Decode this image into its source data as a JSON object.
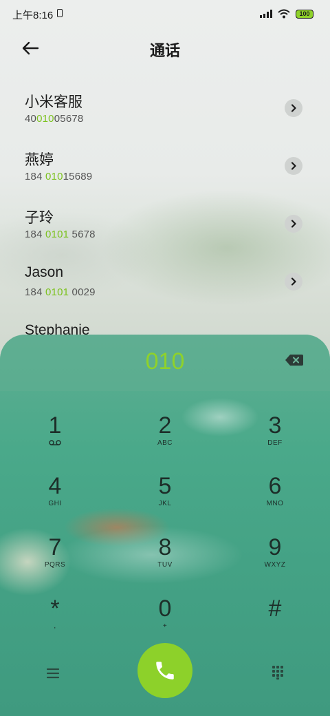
{
  "status": {
    "time": "上午8:16",
    "battery": "100"
  },
  "header": {
    "title": "通话"
  },
  "contacts": [
    {
      "name": "小米客服",
      "num_pre": "40",
      "num_hl": "010",
      "num_post": "05678"
    },
    {
      "name": "燕婷",
      "num_pre": "184 ",
      "num_hl": "010",
      "num_post": "15689"
    },
    {
      "name": "子玲",
      "num_pre": "184 ",
      "num_hl": "0101",
      "num_post": " 5678"
    },
    {
      "name": "Jason",
      "num_pre": "184 ",
      "num_hl": "0101",
      "num_post": " 0029"
    },
    {
      "name": "Stephanie",
      "num_pre": "",
      "num_hl": "",
      "num_post": ""
    }
  ],
  "dialer": {
    "number": "010",
    "keys": [
      {
        "digit": "1",
        "letters": ""
      },
      {
        "digit": "2",
        "letters": "ABC"
      },
      {
        "digit": "3",
        "letters": "DEF"
      },
      {
        "digit": "4",
        "letters": "GHI"
      },
      {
        "digit": "5",
        "letters": "JKL"
      },
      {
        "digit": "6",
        "letters": "MNO"
      },
      {
        "digit": "7",
        "letters": "PQRS"
      },
      {
        "digit": "8",
        "letters": "TUV"
      },
      {
        "digit": "9",
        "letters": "WXYZ"
      },
      {
        "digit": "*",
        "letters": ","
      },
      {
        "digit": "0",
        "letters": "+"
      },
      {
        "digit": "#",
        "letters": ""
      }
    ]
  },
  "colors": {
    "accent": "#8dd12a",
    "highlight": "#7cc21e",
    "dialpad": "#4aa98a"
  },
  "icons": {
    "back": "arrow-left-icon",
    "chevron": "chevron-right-icon",
    "delete": "backspace-icon",
    "menu": "menu-icon",
    "call": "phone-icon",
    "dialpad": "dialpad-icon",
    "voicemail": "voicemail-icon"
  }
}
